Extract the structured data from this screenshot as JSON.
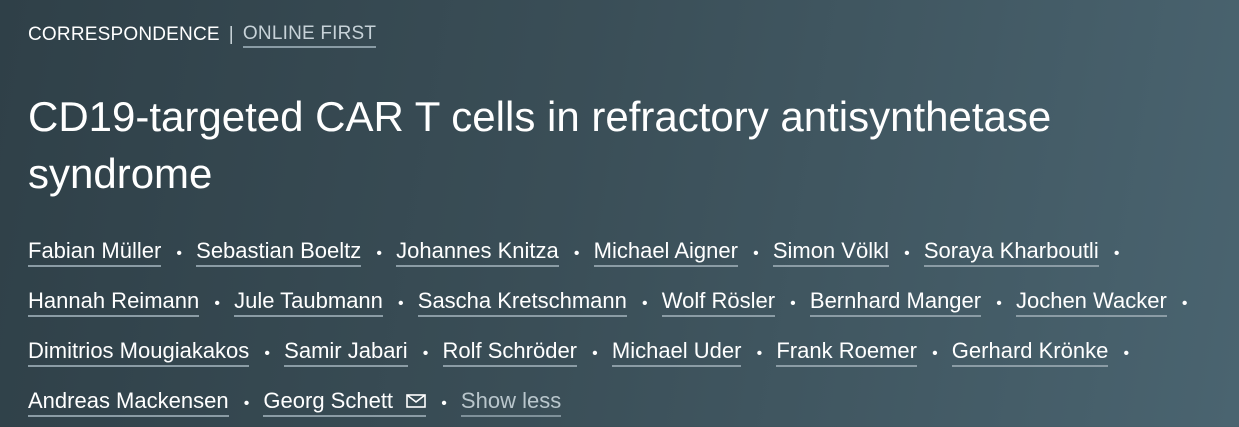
{
  "article": {
    "type_label": "CORRESPONDENCE",
    "separator": "|",
    "status_label": "ONLINE FIRST",
    "title": "CD19-targeted CAR T cells in refractory antisynthetase syndrome"
  },
  "authors": [
    "Fabian Müller",
    "Sebastian Boeltz",
    "Johannes Knitza",
    "Michael Aigner",
    "Simon Völkl",
    "Soraya Kharboutli",
    "Hannah Reimann",
    "Jule Taubmann",
    "Sascha Kretschmann",
    "Wolf Rösler",
    "Bernhard Manger",
    "Jochen Wacker",
    "Dimitrios Mougiakakos",
    "Samir Jabari",
    "Rolf Schröder",
    "Michael Uder",
    "Frank Roemer",
    "Gerhard Krönke",
    "Andreas Mackensen",
    "Georg Schett"
  ],
  "author_separator": "•",
  "corresponding_icon": "envelope-icon",
  "toggle_label": "Show less",
  "colors": {
    "background_start": "#2f4048",
    "background_end": "#4a6470",
    "underline": "#8b9ca5",
    "muted_text": "#b9c6cc"
  }
}
